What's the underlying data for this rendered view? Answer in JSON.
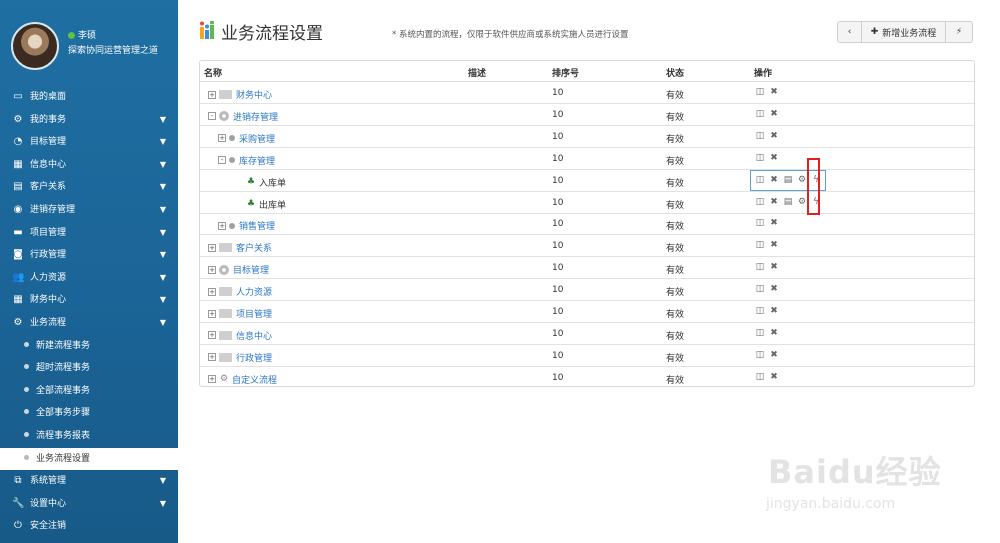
{
  "sidebar": {
    "user": {
      "name": "李硕",
      "subtitle": "探索协同运营管理之道"
    },
    "items": [
      {
        "key": "desktop",
        "label": "我的桌面",
        "icon": "monitor-icon",
        "caret": false
      },
      {
        "key": "my-affairs",
        "label": "我的事务",
        "icon": "gear-icon",
        "caret": true
      },
      {
        "key": "goals",
        "label": "目标管理",
        "icon": "pie-icon",
        "caret": true
      },
      {
        "key": "info",
        "label": "信息中心",
        "icon": "calendar-icon",
        "caret": true
      },
      {
        "key": "crm",
        "label": "客户关系",
        "icon": "contact-card-icon",
        "caret": true
      },
      {
        "key": "psi",
        "label": "进销存管理",
        "icon": "disc-icon",
        "caret": true
      },
      {
        "key": "projects",
        "label": "项目管理",
        "icon": "folder-icon",
        "caret": true
      },
      {
        "key": "admin",
        "label": "行政管理",
        "icon": "camera-icon",
        "caret": true
      },
      {
        "key": "hr",
        "label": "人力资源",
        "icon": "users-icon",
        "caret": true
      },
      {
        "key": "finance",
        "label": "财务中心",
        "icon": "calculator-icon",
        "caret": true
      },
      {
        "key": "workflow",
        "label": "业务流程",
        "icon": "gear-icon",
        "caret": true
      }
    ],
    "workflow_children": [
      {
        "label": "新建流程事务",
        "active": false
      },
      {
        "label": "超时流程事务",
        "active": false
      },
      {
        "label": "全部流程事务",
        "active": false
      },
      {
        "label": "全部事务步骤",
        "active": false
      },
      {
        "label": "流程事务报表",
        "active": false
      },
      {
        "label": "业务流程设置",
        "active": true
      }
    ],
    "bottom_items": [
      {
        "key": "system",
        "label": "系统管理",
        "icon": "windows-icon",
        "caret": true
      },
      {
        "key": "settings",
        "label": "设置中心",
        "icon": "wrench-icon",
        "caret": true
      },
      {
        "key": "logout",
        "label": "安全注销",
        "icon": "power-icon",
        "caret": false
      }
    ]
  },
  "header": {
    "title": "业务流程设置",
    "notice": "* 系统内置的流程，仅限于软件供应商或系统实施人员进行设置",
    "buttons": {
      "prev": "‹",
      "add": "新增业务流程",
      "quick": "⚡"
    }
  },
  "table": {
    "columns": [
      "名称",
      "描述",
      "排序号",
      "状态",
      "操作"
    ],
    "rows": [
      {
        "name": "财务中心",
        "level": 0,
        "node": "folder",
        "expander": "+",
        "order": "10",
        "status": "有效",
        "ops": 2
      },
      {
        "name": "进销存管理",
        "level": 0,
        "node": "disc",
        "expander": "-",
        "order": "10",
        "status": "有效",
        "ops": 2
      },
      {
        "name": "采购管理",
        "level": 1,
        "node": "dot",
        "expander": "+",
        "order": "10",
        "status": "有效",
        "ops": 2
      },
      {
        "name": "库存管理",
        "level": 1,
        "node": "dot",
        "expander": "-",
        "order": "10",
        "status": "有效",
        "ops": 2
      },
      {
        "name": "入库单",
        "level": 2,
        "node": "tree",
        "expander": "",
        "order": "10",
        "status": "有效",
        "ops": 5,
        "highlight": true
      },
      {
        "name": "出库单",
        "level": 2,
        "node": "tree",
        "expander": "",
        "order": "10",
        "status": "有效",
        "ops": 5
      },
      {
        "name": "销售管理",
        "level": 1,
        "node": "dot",
        "expander": "+",
        "order": "10",
        "status": "有效",
        "ops": 2
      },
      {
        "name": "客户关系",
        "level": 0,
        "node": "folder",
        "expander": "+",
        "order": "10",
        "status": "有效",
        "ops": 2
      },
      {
        "name": "目标管理",
        "level": 0,
        "node": "disc",
        "expander": "+",
        "order": "10",
        "status": "有效",
        "ops": 2
      },
      {
        "name": "人力资源",
        "level": 0,
        "node": "folder",
        "expander": "+",
        "order": "10",
        "status": "有效",
        "ops": 2
      },
      {
        "name": "项目管理",
        "level": 0,
        "node": "folder",
        "expander": "+",
        "order": "10",
        "status": "有效",
        "ops": 2
      },
      {
        "name": "信息中心",
        "level": 0,
        "node": "folder",
        "expander": "+",
        "order": "10",
        "status": "有效",
        "ops": 2
      },
      {
        "name": "行政管理",
        "level": 0,
        "node": "folder",
        "expander": "+",
        "order": "10",
        "status": "有效",
        "ops": 2
      },
      {
        "name": "自定义流程",
        "level": 0,
        "node": "gear",
        "expander": "+",
        "order": "10",
        "status": "有效",
        "ops": 2
      }
    ],
    "op_icons": [
      "columns-icon",
      "close-icon",
      "document-icon",
      "gears-icon",
      "lightning-icon"
    ]
  },
  "watermark": {
    "text": "Baidu经验",
    "sub": "jingyan.baidu.com"
  },
  "colors": {
    "sidebar": "#1b6497",
    "link": "#2a76c6",
    "highlight_box": "#e02020",
    "row_focus": "#5aa0d8"
  }
}
